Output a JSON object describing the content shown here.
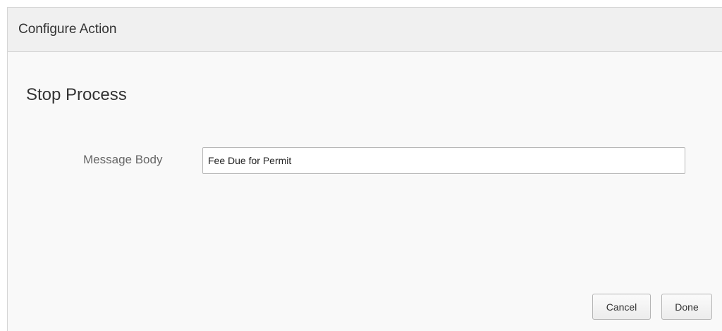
{
  "dialog": {
    "title": "Configure Action",
    "section_title": "Stop Process",
    "field": {
      "label": "Message Body",
      "value": "Fee Due for Permit"
    },
    "buttons": {
      "cancel_label": "Cancel",
      "done_label": "Done"
    }
  }
}
